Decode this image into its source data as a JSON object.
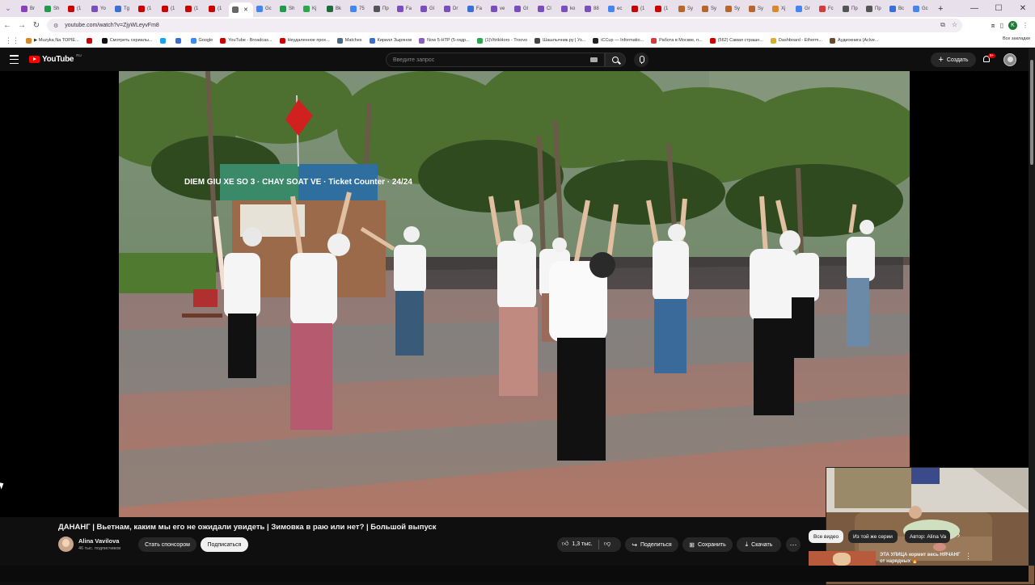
{
  "browser": {
    "tabs": [
      {
        "label": "Br",
        "color": "#8a3fbd"
      },
      {
        "label": "Sh",
        "color": "#1f9c4a"
      },
      {
        "label": "(1",
        "color": "#cc0000"
      },
      {
        "label": "Yo",
        "color": "#7a4fbd"
      },
      {
        "label": "Tg",
        "color": "#3a6fd8"
      },
      {
        "label": "(1",
        "color": "#cc0000"
      },
      {
        "label": "(1",
        "color": "#cc0000"
      },
      {
        "label": "(1",
        "color": "#cc0000"
      },
      {
        "label": "(1",
        "color": "#cc0000"
      },
      {
        "label": "",
        "color": "#666666",
        "active": true
      },
      {
        "label": "Gc",
        "color": "#4285f4"
      },
      {
        "label": "Sh",
        "color": "#1f9c4a"
      },
      {
        "label": "Kj",
        "color": "#2aa84a"
      },
      {
        "label": "Bk",
        "color": "#1f6b3a"
      },
      {
        "label": "75",
        "color": "#4285f4"
      },
      {
        "label": "Пр",
        "color": "#555555"
      },
      {
        "label": "Fa",
        "color": "#7a4fbd"
      },
      {
        "label": "Gl",
        "color": "#7a4fbd"
      },
      {
        "label": "Dr",
        "color": "#7a4fbd"
      },
      {
        "label": "Fa",
        "color": "#3a6fd8"
      },
      {
        "label": "ve",
        "color": "#7a4fbd"
      },
      {
        "label": "Gl",
        "color": "#7a4fbd"
      },
      {
        "label": "Cl",
        "color": "#7a4fbd"
      },
      {
        "label": "ko",
        "color": "#7a4fbd"
      },
      {
        "label": "88",
        "color": "#7a4fbd"
      },
      {
        "label": "ec",
        "color": "#4285f4"
      },
      {
        "label": "(1",
        "color": "#cc0000"
      },
      {
        "label": "(1",
        "color": "#cc0000"
      },
      {
        "label": "Sy",
        "color": "#b8672a"
      },
      {
        "label": "Sy",
        "color": "#b8672a"
      },
      {
        "label": "Sy",
        "color": "#b8672a"
      },
      {
        "label": "Sy",
        "color": "#b8672a"
      },
      {
        "label": "Xj",
        "color": "#d88a2a"
      },
      {
        "label": "Gr",
        "color": "#4285f4"
      },
      {
        "label": "Fc",
        "color": "#d83a3a"
      },
      {
        "label": "Пр",
        "color": "#555555"
      },
      {
        "label": "Пр",
        "color": "#555555"
      },
      {
        "label": "Вс",
        "color": "#3a6fd8"
      },
      {
        "label": "Gc",
        "color": "#4285f4"
      }
    ],
    "new_tab": "+",
    "window_controls": {
      "minimize": "—",
      "maximize": "☐",
      "close": "✕"
    },
    "url": "youtube.com/watch?v=ZjyWLeyvFm8",
    "profile_letter": "K",
    "bookmarks": [
      {
        "label": "▶ Muzyka Na TOPIE...",
        "color": "#d88a2a"
      },
      {
        "label": "",
        "color": "#cc0000"
      },
      {
        "label": "Смотреть сериалы...",
        "color": "#111111"
      },
      {
        "label": "",
        "color": "#1da1f2"
      },
      {
        "label": "",
        "color": "#3a6fd8"
      },
      {
        "label": "Google",
        "color": "#4285f4"
      },
      {
        "label": "YouTube - Broadcas...",
        "color": "#cc0000"
      },
      {
        "label": "Неудаленное прох...",
        "color": "#cc0000"
      },
      {
        "label": "Matches",
        "color": "#4a6a8a"
      },
      {
        "label": "Кирилл Зырянов",
        "color": "#3a6fd8"
      },
      {
        "label": "Now 5-HTP (5-гидр...",
        "color": "#8a5fbd"
      },
      {
        "label": "(1)VitrikHoro - Troovo",
        "color": "#2aa84a"
      },
      {
        "label": "Шашлычник.ру | Уз...",
        "color": "#444444"
      },
      {
        "label": "iCCup — Informatio...",
        "color": "#222222"
      },
      {
        "label": "Работа в Москве, п...",
        "color": "#d83a3a"
      },
      {
        "label": "(562) Самая страшн...",
        "color": "#cc0000"
      },
      {
        "label": "Dashboard - Etherm...",
        "color": "#d8b02a"
      },
      {
        "label": "Аудиокнига (Асlve...",
        "color": "#6a4a2a"
      }
    ],
    "all_bookmarks": "Все закладки"
  },
  "youtube": {
    "logo_text": "YouTube",
    "logo_region": "RU",
    "search": {
      "placeholder": "Введите запрос"
    },
    "create_label": "Создать",
    "notifications_badge": "9+"
  },
  "video": {
    "title": "ДАНАНГ | Вьетнам, каким мы его не ожидали увидеть | Зимовка в раю или нет? | Большой выпуск",
    "sign_text": "DIEM GIU XE SO 3 · CHAY SOAT VE · Ticket Counter · 24/24",
    "channel": {
      "name": "Alina Vavilova",
      "subscribers": "46 тыс. подписчиков"
    },
    "actions": {
      "sponsor": "Стать спонсором",
      "subscribe": "Подписаться",
      "likes": "1,3 тыс.",
      "share": "Поделиться",
      "save": "Сохранить",
      "download": "Скачать",
      "more": "⋯"
    }
  },
  "sidebar": {
    "chips": [
      "Все видео",
      "Из той же серии",
      "Автор: Alina Va"
    ],
    "next_arrow": "›",
    "recommendation": {
      "title": "ЭТА УЛИЦА кормит весь НЯЧАНГ от нарядных 🔥",
      "menu": "⋮"
    }
  }
}
